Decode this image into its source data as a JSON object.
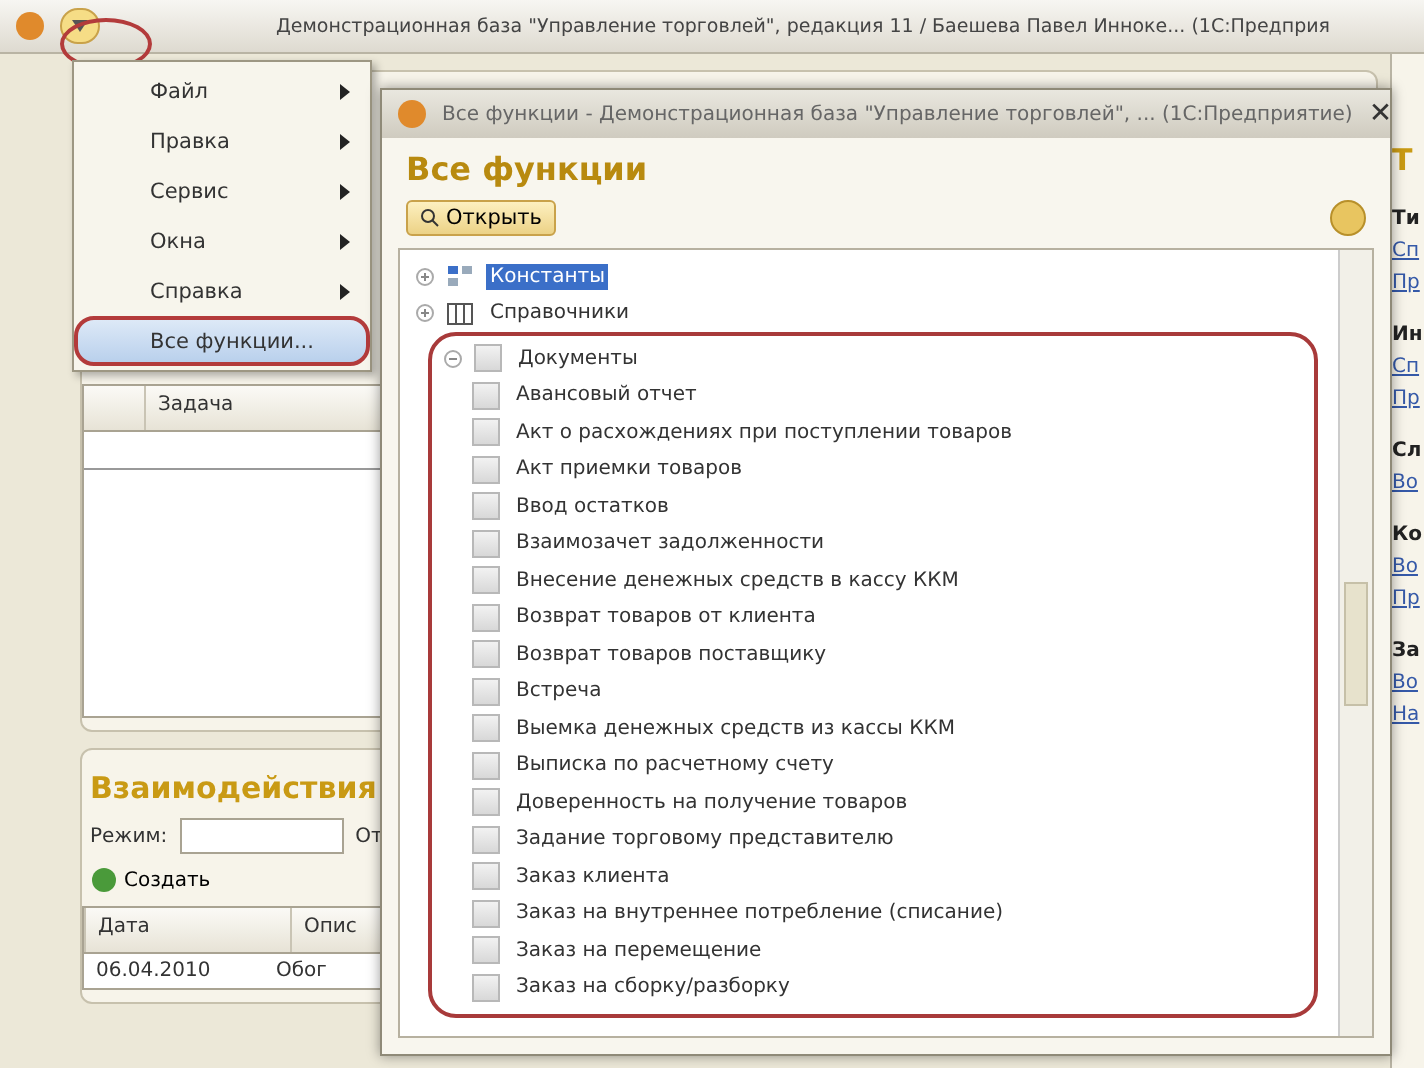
{
  "window": {
    "title": "Демонстрационная база \"Управление торговлей\", редакция 11 / Баешева Павел Инноке... (1С:Предприя"
  },
  "main_menu": {
    "items": [
      {
        "label": "Файл",
        "submenu": true,
        "selected": false
      },
      {
        "label": "Правка",
        "submenu": true,
        "selected": false
      },
      {
        "label": "Сервис",
        "submenu": true,
        "selected": false
      },
      {
        "label": "Окна",
        "submenu": true,
        "selected": false
      },
      {
        "label": "Справка",
        "submenu": true,
        "selected": false
      },
      {
        "label": "Все функции...",
        "submenu": false,
        "selected": true
      }
    ]
  },
  "tasks_table": {
    "columns": [
      "Задача"
    ]
  },
  "interactions": {
    "title": "Взаимодействия",
    "mode_label": "Режим:",
    "cut_label": "От",
    "create_button": "Создать",
    "columns": [
      "Дата",
      "Опис"
    ],
    "rows": [
      {
        "date": "06.04.2010",
        "description": "Обог"
      }
    ]
  },
  "right_strip": {
    "items": [
      {
        "kind": "title",
        "text": "Т"
      },
      {
        "kind": "heading",
        "text": "Ти"
      },
      {
        "kind": "link",
        "text": "Сп"
      },
      {
        "kind": "link",
        "text": "Пр"
      },
      {
        "kind": "heading",
        "text": "Ин"
      },
      {
        "kind": "link",
        "text": "Сп"
      },
      {
        "kind": "link",
        "text": "Пр"
      },
      {
        "kind": "heading",
        "text": "Сл"
      },
      {
        "kind": "link",
        "text": "Во"
      },
      {
        "kind": "heading",
        "text": "Ко"
      },
      {
        "kind": "link",
        "text": "Во"
      },
      {
        "kind": "link",
        "text": "Пр"
      },
      {
        "kind": "heading",
        "text": "За"
      },
      {
        "kind": "link",
        "text": "Во"
      },
      {
        "kind": "link",
        "text": "На"
      }
    ]
  },
  "dialog": {
    "title": "Все функции - Демонстрационная база \"Управление торговлей\", ... (1С:Предприятие)",
    "heading": "Все функции",
    "open_button": "Открыть",
    "close": "✕",
    "tree": [
      {
        "label": "Константы",
        "kind": "constants",
        "selected": true,
        "expanded": false
      },
      {
        "label": "Справочники",
        "kind": "catalogs",
        "selected": false,
        "expanded": false
      },
      {
        "label": "Документы",
        "kind": "folder",
        "selected": false,
        "expanded": true,
        "children": [
          {
            "label": "Авансовый отчет",
            "kind": "document",
            "selected": false
          },
          {
            "label": "Акт о расхождениях при поступлении товаров",
            "kind": "document",
            "selected": false
          },
          {
            "label": "Акт приемки товаров",
            "kind": "document",
            "selected": false
          },
          {
            "label": "Ввод остатков",
            "kind": "document",
            "selected": false
          },
          {
            "label": "Взаимозачет задолженности",
            "kind": "document",
            "selected": false
          },
          {
            "label": "Внесение денежных средств в кассу ККМ",
            "kind": "document",
            "selected": false
          },
          {
            "label": "Возврат товаров от клиента",
            "kind": "document",
            "selected": false
          },
          {
            "label": "Возврат товаров поставщику",
            "kind": "document",
            "selected": false
          },
          {
            "label": "Встреча",
            "kind": "document",
            "selected": false
          },
          {
            "label": "Выемка денежных средств из кассы ККМ",
            "kind": "document",
            "selected": false
          },
          {
            "label": "Выписка по расчетному счету",
            "kind": "document",
            "selected": false
          },
          {
            "label": "Доверенность на получение товаров",
            "kind": "document",
            "selected": false
          },
          {
            "label": "Задание торговому представителю",
            "kind": "document",
            "selected": false
          },
          {
            "label": "Заказ клиента",
            "kind": "document",
            "selected": false
          },
          {
            "label": "Заказ на внутреннее потребление (списание)",
            "kind": "document",
            "selected": false
          },
          {
            "label": "Заказ на перемещение",
            "kind": "document",
            "selected": false
          },
          {
            "label": "Заказ на сборку/разборку",
            "kind": "document",
            "selected": false
          }
        ]
      }
    ]
  }
}
